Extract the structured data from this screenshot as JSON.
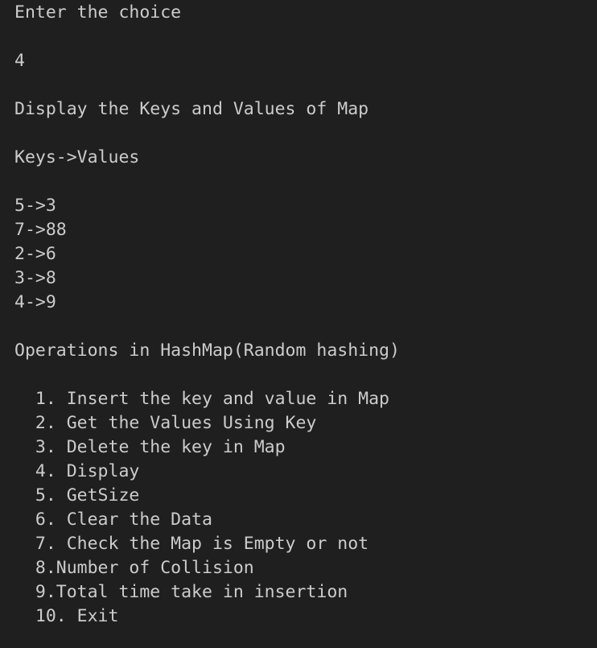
{
  "terminal": {
    "prompt": "Enter the choice",
    "input": "4",
    "display_heading": "Display the Keys and Values of Map",
    "table_header": "Keys->Values",
    "entries": [
      "5->3",
      "7->88",
      "2->6",
      "3->8",
      "4->9"
    ],
    "menu_title": "Operations in HashMap(Random hashing)",
    "menu_items": [
      "  1. Insert the key and value in Map",
      "  2. Get the Values Using Key",
      "  3. Delete the key in Map",
      "  4. Display",
      "  5. GetSize",
      "  6. Clear the Data",
      "  7. Check the Map is Empty or not",
      "  8.Number of Collision",
      "  9.Total time take in insertion",
      "  10. Exit"
    ]
  }
}
